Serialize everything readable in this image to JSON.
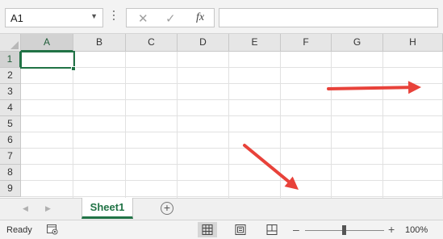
{
  "formula_bar": {
    "name_box": "A1",
    "formula_value": "",
    "cancel_icon": "✕",
    "enter_icon": "✓",
    "function_icon": "fx"
  },
  "grid": {
    "columns": [
      "A",
      "B",
      "C",
      "D",
      "E",
      "F",
      "G",
      "H"
    ],
    "rows": [
      "1",
      "2",
      "3",
      "4",
      "5",
      "6",
      "7",
      "8",
      "9"
    ],
    "active_column": "A",
    "active_row": "1"
  },
  "annotations": {
    "arrow_color": "#e8423a",
    "arrow_count": 2
  },
  "sheet_tabs": {
    "tabs": [
      "Sheet1"
    ],
    "active": "Sheet1",
    "add_icon": "+"
  },
  "status_bar": {
    "status": "Ready",
    "zoom_minus": "–",
    "zoom_plus": "+",
    "zoom_level": "100%"
  },
  "colors": {
    "accent": "#217346",
    "header_bg": "#e6e6e6",
    "gridline": "#e1e1e1"
  }
}
